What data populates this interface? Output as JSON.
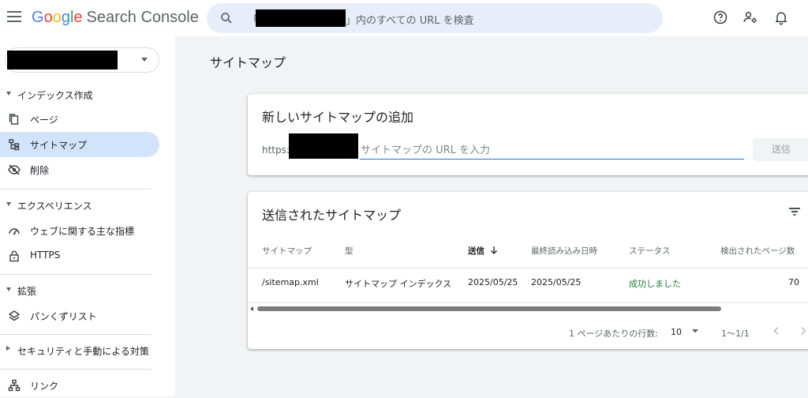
{
  "header": {
    "app_title_google": "Google",
    "app_title_product": "Search Console",
    "search": {
      "open_bracket": "「",
      "close_bracket": "」",
      "suffix": "内のすべての URL を検査"
    },
    "brand_colors": [
      "#4285f4",
      "#ea4335",
      "#fbbc05",
      "#4285f4",
      "#34a853",
      "#ea4335"
    ],
    "icons": [
      "help-icon",
      "manage-users-icon",
      "notifications-icon"
    ]
  },
  "sidebar": {
    "sections": [
      {
        "label": "インデックス作成",
        "expanded": true,
        "items": [
          {
            "label": "ページ",
            "icon": "pages-icon"
          },
          {
            "label": "サイトマップ",
            "icon": "sitemap-icon",
            "active": true
          },
          {
            "label": "削除",
            "icon": "removals-icon"
          }
        ]
      },
      {
        "label": "エクスペリエンス",
        "expanded": true,
        "items": [
          {
            "label": "ウェブに関する主な指標",
            "icon": "speed-icon"
          },
          {
            "label": "HTTPS",
            "icon": "lock-icon"
          }
        ]
      },
      {
        "label": "拡張",
        "expanded": true,
        "items": [
          {
            "label": "パンくずリスト",
            "icon": "layers-icon"
          }
        ]
      },
      {
        "label": "セキュリティと手動による対策",
        "expanded": false,
        "items": []
      },
      {
        "label": "",
        "expanded": false,
        "items": [
          {
            "label": "リンク",
            "icon": "links-icon"
          }
        ]
      }
    ],
    "active_color": "#d2e3fc"
  },
  "main": {
    "page_title": "サイトマップ",
    "add_card": {
      "title": "新しいサイトマップの追加",
      "url_prefix": "https:",
      "input_placeholder": "サイトマップの URL を入力",
      "submit_label": "送信"
    },
    "submitted_card": {
      "title": "送信されたサイトマップ",
      "columns": [
        "サイトマップ",
        "型",
        "送信",
        "最終読み込み日時",
        "ステータス",
        "検出されたページ数"
      ],
      "sorted_column": "送信",
      "rows": [
        {
          "sitemap": "/sitemap.xml",
          "type": "サイトマップ インデックス",
          "submitted": "2025/05/25",
          "last_read": "2025/05/25",
          "status": "成功しました",
          "pages": "70"
        }
      ],
      "pagination": {
        "rows_per_page_label": "1 ページあたりの行数:",
        "rows_per_page": "10",
        "range": "1〜1/1"
      },
      "status_color": "#188038"
    }
  }
}
